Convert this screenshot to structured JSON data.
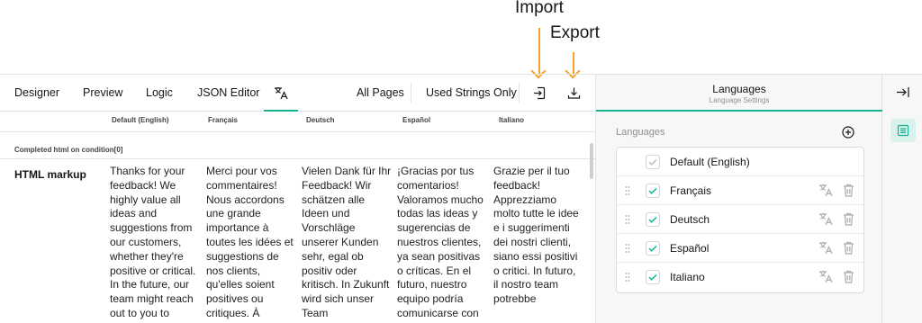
{
  "callouts": {
    "import": "Import",
    "export": "Export"
  },
  "toolbar": {
    "tabs": [
      "Designer",
      "Preview",
      "Logic",
      "JSON Editor"
    ],
    "translation_icon": "translation-icon",
    "all_pages": "All Pages",
    "used_strings": "Used Strings Only",
    "import_icon": "import-icon",
    "export_icon": "export-icon"
  },
  "grid": {
    "columns": [
      "Default (English)",
      "Français",
      "Deutsch",
      "Español",
      "Italiano"
    ],
    "section": "Completed html on condition[0]",
    "row_label": "HTML markup",
    "cells": [
      "Thanks for your feedback! We highly value all ideas and suggestions from our customers, whether they're positive or critical. In the future, our team might reach out to you to",
      "Merci pour vos commentaires! Nous accordons une grande importance à toutes les idées et suggestions de nos clients, qu'elles soient positives ou critiques. À",
      "Vielen Dank für Ihr Feedback! Wir schätzen alle Ideen und Vorschläge unserer Kunden sehr, egal ob positiv oder kritisch. In Zukunft wird sich unser Team",
      "¡Gracias por tus comentarios! Valoramos mucho todas las ideas y sugerencias de nuestros clientes, ya sean positivas o críticas. En el futuro, nuestro equipo podría comunicarse con",
      "Grazie per il tuo feedback! Apprezziamo molto tutte le idee e i suggerimenti dei nostri clienti, siano essi positivi o critici. In futuro, il nostro team potrebbe"
    ]
  },
  "panel": {
    "title": "Languages",
    "subtitle": "Language Settings",
    "label": "Languages",
    "add_icon": "add-circle-icon",
    "items": [
      {
        "label": "Default (English)"
      },
      {
        "label": "Français"
      },
      {
        "label": "Deutsch"
      },
      {
        "label": "Español"
      },
      {
        "label": "Italiano"
      }
    ]
  },
  "sidebar": {
    "collapse_icon": "collapse-panel-icon",
    "settings_icon": "property-grid-icon"
  },
  "colors": {
    "accent": "#19b394",
    "callout_arrow": "#f5a12a",
    "check": "#19b394"
  }
}
